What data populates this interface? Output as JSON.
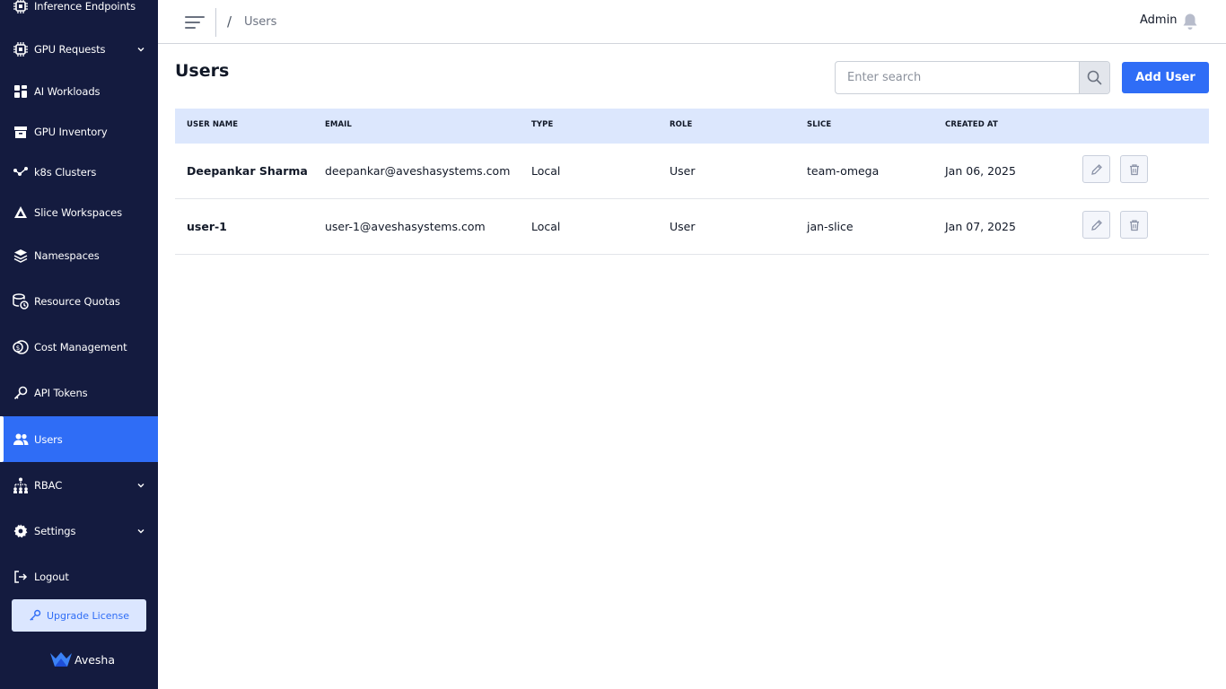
{
  "sidebar": {
    "items": [
      {
        "label": "Inference Endpoints",
        "icon": "chip-icon",
        "expandable": false
      },
      {
        "label": "GPU Requests",
        "icon": "chip-icon",
        "expandable": true
      },
      {
        "label": "AI Workloads",
        "icon": "workloads-icon",
        "expandable": false
      },
      {
        "label": "GPU Inventory",
        "icon": "archive-icon",
        "expandable": false
      },
      {
        "label": "k8s Clusters",
        "icon": "clusters-icon",
        "expandable": false
      },
      {
        "label": "Slice Workspaces",
        "icon": "slice-icon",
        "expandable": false
      },
      {
        "label": "Namespaces",
        "icon": "layers-icon",
        "expandable": false
      },
      {
        "label": "Resource Quotas",
        "icon": "quota-icon",
        "expandable": false
      },
      {
        "label": "Cost Management",
        "icon": "cost-icon",
        "expandable": false
      },
      {
        "label": "API Tokens",
        "icon": "key-icon",
        "expandable": false
      },
      {
        "label": "Users",
        "icon": "users-icon",
        "expandable": false,
        "active": true
      },
      {
        "label": "RBAC",
        "icon": "rbac-icon",
        "expandable": true
      },
      {
        "label": "Settings",
        "icon": "gear-icon",
        "expandable": true
      },
      {
        "label": "Logout",
        "icon": "logout-icon",
        "expandable": false
      }
    ],
    "upgrade_label": "Upgrade License",
    "brand_name": "Avesha"
  },
  "header": {
    "breadcrumb_separator": "/",
    "breadcrumb_current": "Users",
    "user_label": "Admin"
  },
  "main": {
    "title": "Users",
    "search_placeholder": "Enter search",
    "add_button_label": "Add User",
    "columns": [
      "USER NAME",
      "EMAIL",
      "TYPE",
      "ROLE",
      "SLICE",
      "CREATED AT"
    ],
    "rows": [
      {
        "name": "Deepankar Sharma",
        "email": "deepankar@aveshasystems.com",
        "type": "Local",
        "role": "User",
        "slice": "team-omega",
        "created": "Jan 06, 2025"
      },
      {
        "name": "user-1",
        "email": "user-1@aveshasystems.com",
        "type": "Local",
        "role": "User",
        "slice": "jan-slice",
        "created": "Jan 07, 2025"
      }
    ]
  },
  "colors": {
    "sidebar_bg": "#141b3f",
    "accent": "#2f6df6",
    "table_header_bg": "#dce7fd"
  }
}
